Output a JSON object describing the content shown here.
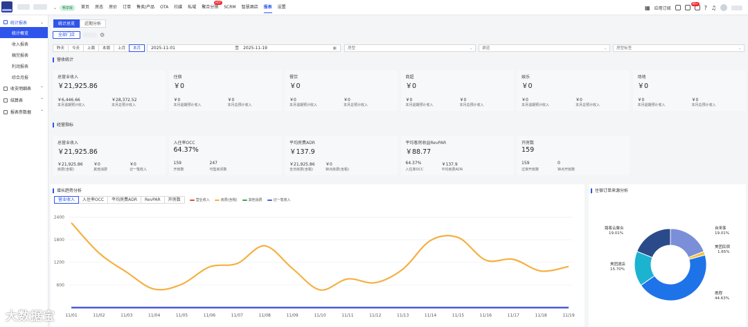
{
  "header": {
    "badge": "畅享版",
    "nav": [
      "首页",
      "房态",
      "房价",
      "订单",
      "售卖/产品",
      "OTA",
      "社媒",
      "私域",
      "聚合分销",
      "SCRM",
      "智慧酒店",
      "报表",
      "设置"
    ],
    "active_index": 11,
    "hot_badge": "HOT",
    "right_label": "应用订阅",
    "notif_count": "99+"
  },
  "sidebar": {
    "groups": [
      {
        "label": "统计报表",
        "open": true,
        "items": [
          {
            "label": "统计概览",
            "active": true
          },
          {
            "label": "收入报表"
          },
          {
            "label": "稿完报表"
          },
          {
            "label": "利润报表"
          },
          {
            "label": "综合月报"
          }
        ]
      },
      {
        "label": "收支明细表"
      },
      {
        "label": "结算表"
      },
      {
        "label": "报表参数据"
      }
    ]
  },
  "tabs": [
    "统计总览",
    "近期分析"
  ],
  "store_button": "全部门店",
  "filters": {
    "date_buttons": [
      "昨天",
      "今天",
      "上周",
      "本周",
      "上月",
      "本月"
    ],
    "active_date": 5,
    "start_date": "2025-11-01",
    "range_sep": "至",
    "end_date": "2025-11-19",
    "selects": [
      "房型",
      "渠道",
      "房型标签"
    ]
  },
  "revenue": {
    "title": "营收统计",
    "cards": [
      {
        "title": "总营业收入",
        "value": "￥21,925.86",
        "subs": [
          {
            "v": "￥6,446.66",
            "l": "本月退期预计收入"
          },
          {
            "v": "￥28,372.52",
            "l": "本月总预计收入"
          }
        ]
      },
      {
        "title": "住宿",
        "value": "￥0",
        "subs": [
          {
            "v": "￥0",
            "l": "本月退期预计收入"
          },
          {
            "v": "￥0",
            "l": "本月总预计收入"
          }
        ]
      },
      {
        "title": "餐饮",
        "value": "￥0",
        "subs": [
          {
            "v": "￥0",
            "l": "本月退期预计收入"
          },
          {
            "v": "￥0",
            "l": "本月总预计收入"
          }
        ]
      },
      {
        "title": "商超",
        "value": "￥0",
        "subs": [
          {
            "v": "￥0",
            "l": "本月退期预计收入"
          },
          {
            "v": "￥0",
            "l": "本月总预计收入"
          }
        ]
      },
      {
        "title": "娱乐",
        "value": "￥0",
        "subs": [
          {
            "v": "￥0",
            "l": "本月退期预计收入"
          },
          {
            "v": "￥0",
            "l": "本月总预计收入"
          }
        ]
      },
      {
        "title": "场地",
        "value": "￥0",
        "subs": [
          {
            "v": "￥0",
            "l": "本月退期预计收入"
          },
          {
            "v": "￥0",
            "l": "本月总预计收入"
          }
        ]
      }
    ]
  },
  "ops": {
    "title": "经营指标",
    "cards": [
      {
        "title": "总营业收入",
        "value": "￥21,925.86",
        "subs": [
          {
            "v": "￥21,925.86",
            "l": "房费(含税)"
          },
          {
            "v": "￥0",
            "l": "其他消费"
          },
          {
            "v": "￥0",
            "l": "记一笔收入"
          }
        ]
      },
      {
        "title": "入住率OCC",
        "value": "64.37%",
        "subs": [
          {
            "v": "159",
            "l": "开房数"
          },
          {
            "v": "247",
            "l": "可售房间数"
          }
        ]
      },
      {
        "title": "平均房费ADR",
        "value": "￥137.9",
        "subs": [
          {
            "v": "￥21,925.86",
            "l": "全日房费(含税)"
          },
          {
            "v": "￥0",
            "l": "钟点房费(含税)"
          }
        ]
      },
      {
        "title": "平均客房收益RevPAR",
        "value": "￥88.77",
        "subs": [
          {
            "v": "64.37%",
            "l": "入住率OCC"
          },
          {
            "v": "￥137.9",
            "l": "平均房费ADR"
          }
        ]
      },
      {
        "title": "开房数",
        "value": "159",
        "subs": [
          {
            "v": "159",
            "l": "过夜开房数"
          },
          {
            "v": "0",
            "l": "钟点开房数"
          }
        ]
      }
    ]
  },
  "trend": {
    "title": "增长趋势分析",
    "tabs": [
      "营业收入",
      "入住率OCC",
      "平均房费ADR",
      "RevPAR",
      "开房数"
    ],
    "legend": [
      {
        "name": "营业收入",
        "color": "#e8453c"
      },
      {
        "name": "房费(含税)",
        "color": "#f5b040"
      },
      {
        "name": "其他消费",
        "color": "#3aa54a"
      },
      {
        "name": "记一笔收入",
        "color": "#4a5bd6"
      }
    ]
  },
  "chart_data": [
    {
      "type": "line",
      "x": [
        "11/01",
        "11/02",
        "11/03",
        "11/04",
        "11/05",
        "11/06",
        "11/07",
        "11/08",
        "11/09",
        "11/10",
        "11/11",
        "11/12",
        "11/13",
        "11/14",
        "11/15",
        "11/16",
        "11/17",
        "11/18",
        "11/19"
      ],
      "yticks": [
        600,
        1200,
        1800,
        2400
      ],
      "ylim": [
        0,
        2500
      ],
      "series": [
        {
          "name": "房费(含税)",
          "color": "#f5b040",
          "values": [
            2250,
            1450,
            940,
            490,
            620,
            1080,
            1170,
            1640,
            1040,
            470,
            760,
            660,
            1020,
            1780,
            1860,
            1260,
            1280,
            970,
            1090
          ]
        },
        {
          "name": "记一笔收入",
          "color": "#4a5bd6",
          "values": [
            0,
            0,
            0,
            0,
            0,
            0,
            0,
            0,
            0,
            0,
            0,
            0,
            0,
            0,
            0,
            0,
            0,
            0,
            0
          ]
        }
      ]
    },
    {
      "type": "pie",
      "title": "住宿订单来源分析",
      "slices": [
        {
          "label": "自来客",
          "value": 19.01,
          "color": "#7b8fd8"
        },
        {
          "label": "美团民宿",
          "value": 1.65,
          "color": "#f5c23e"
        },
        {
          "label": "携程",
          "value": 44.63,
          "color": "#1e73e8"
        },
        {
          "label": "美团酒店",
          "value": 15.7,
          "color": "#1bb3cf"
        },
        {
          "label": "路客云聚合",
          "value": 19.01,
          "color": "#2b4a8a"
        }
      ]
    }
  ],
  "pie_labels": [
    {
      "name": "路客云聚合",
      "pct": "19.01%"
    },
    {
      "name": "自来客",
      "pct": "19.01%"
    },
    {
      "name": "美团民宿",
      "pct": "1.65%"
    },
    {
      "name": "美团酒店",
      "pct": "15.70%"
    },
    {
      "name": "携程",
      "pct": "44.63%"
    }
  ],
  "watermark": "大数据宝"
}
